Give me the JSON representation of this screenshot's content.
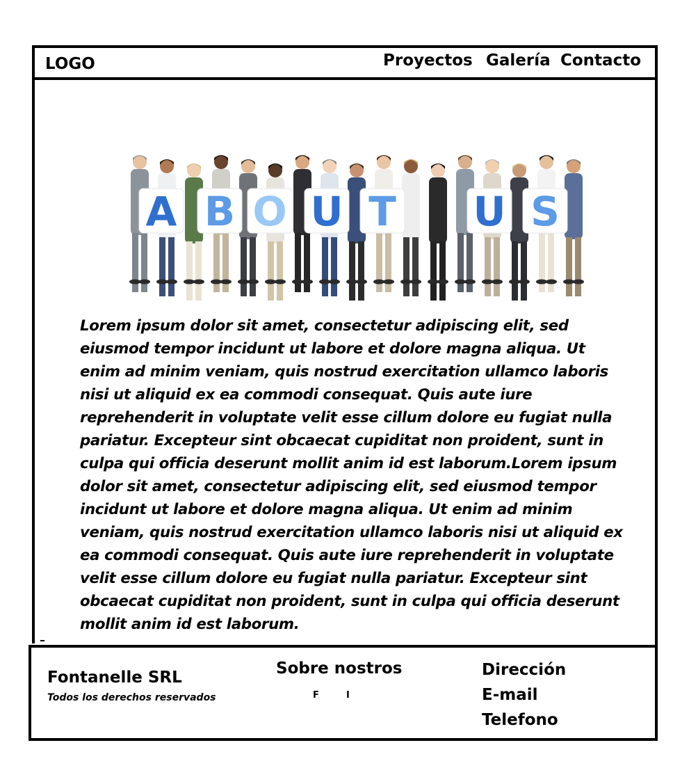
{
  "header": {
    "logo": "LOGO",
    "nav": [
      "Proyectos",
      "Galería",
      "Contacto"
    ]
  },
  "hero": {
    "letters": [
      "A",
      "B",
      "O",
      "U",
      "T",
      "U",
      "S"
    ]
  },
  "content": {
    "paragraph": "Lorem ipsum dolor sit amet, consectetur adipiscing elit, sed eiusmod tempor incidunt ut labore et dolore magna aliqua. Ut enim ad minim veniam, quis nostrud exercitation ullamco laboris nisi ut aliquid ex ea commodi consequat. Quis aute iure reprehenderit in voluptate velit esse cillum dolore eu fugiat nulla pariatur. Excepteur sint obcaecat cupiditat non proident, sunt in culpa qui officia deserunt mollit anim id est laborum.Lorem ipsum dolor sit amet, consectetur adipiscing elit, sed eiusmod tempor incidunt ut labore et dolore magna aliqua. Ut enim ad minim veniam, quis nostrud exercitation ullamco laboris nisi ut aliquid ex ea commodi consequat. Quis aute iure reprehenderit in voluptate velit esse cillum dolore eu fugiat nulla pariatur. Excepteur sint obcaecat cupiditat non proident, sunt in culpa qui officia deserunt mollit anim id est laborum."
  },
  "footer": {
    "company": "Fontanelle SRL",
    "rights": "Todos los derechos reservados",
    "about": "Sobre nostros",
    "social": [
      "F",
      "I"
    ],
    "contact": [
      "Dirección",
      "E-mail",
      "Telefono"
    ]
  }
}
